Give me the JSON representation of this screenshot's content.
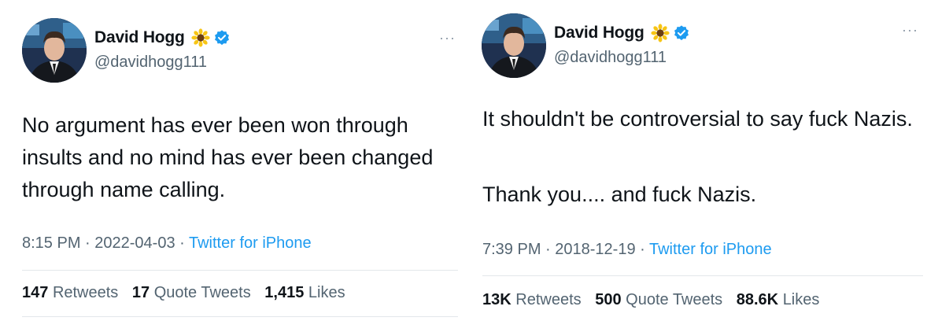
{
  "tweets": [
    {
      "name": "David Hogg",
      "handle": "@davidhogg111",
      "name_emoji": "sunflower-emoji",
      "body": [
        "No argument has ever been won through insults and no mind has ever been changed through name calling."
      ],
      "time": "8:15 PM",
      "date": "2022-04-03",
      "source": "Twitter for iPhone",
      "stats": {
        "retweets_count": "147",
        "retweets_label": "Retweets",
        "quotes_count": "17",
        "quotes_label": "Quote Tweets",
        "likes_count": "1,415",
        "likes_label": "Likes"
      }
    },
    {
      "name": "David Hogg",
      "handle": "@davidhogg111",
      "name_emoji": "sunflower-emoji",
      "body": [
        "It shouldn't be controversial to say fuck Nazis.",
        "Thank you.... and fuck Nazis."
      ],
      "time": "7:39 PM",
      "date": "2018-12-19",
      "source": "Twitter for iPhone",
      "stats": {
        "retweets_count": "13K",
        "retweets_label": "Retweets",
        "quotes_count": "500",
        "quotes_label": "Quote Tweets",
        "likes_count": "88.6K",
        "likes_label": "Likes"
      }
    }
  ],
  "more_icon": "more-horizontal-icon",
  "verified_icon": "verified-badge-icon",
  "colors": {
    "text": "#0f1419",
    "secondary": "#536471",
    "link": "#1d9bf0",
    "verified": "#1d9bf0",
    "divider": "#e3e7ea"
  }
}
